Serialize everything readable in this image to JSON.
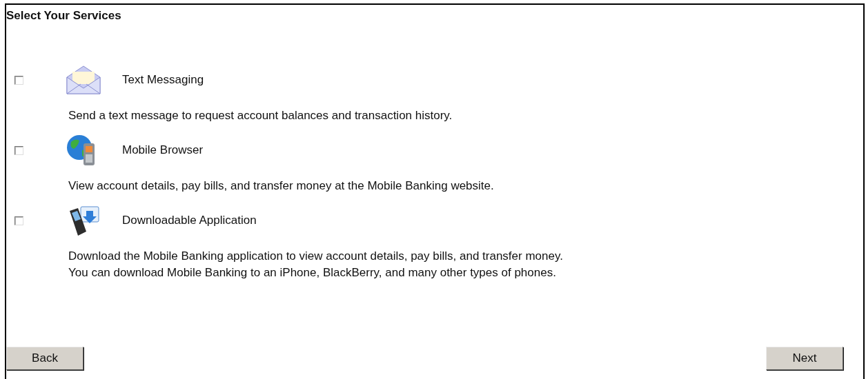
{
  "title": "Select Your Services",
  "services": [
    {
      "kind": "envelope",
      "label": "Text Messaging",
      "checked": false,
      "description": [
        "Send a text message to request account balances and transaction history."
      ]
    },
    {
      "kind": "globe",
      "label": "Mobile Browser",
      "checked": false,
      "description": [
        "View account details, pay bills, and transfer money at the Mobile Banking website."
      ]
    },
    {
      "kind": "download",
      "label": "Downloadable Application",
      "checked": false,
      "description": [
        "Download the Mobile Banking application to view account details, pay bills, and transfer money.",
        "You can download Mobile Banking to an iPhone, BlackBerry, and many other types of phones."
      ]
    }
  ],
  "buttons": {
    "back": "Back",
    "next": "Next"
  }
}
